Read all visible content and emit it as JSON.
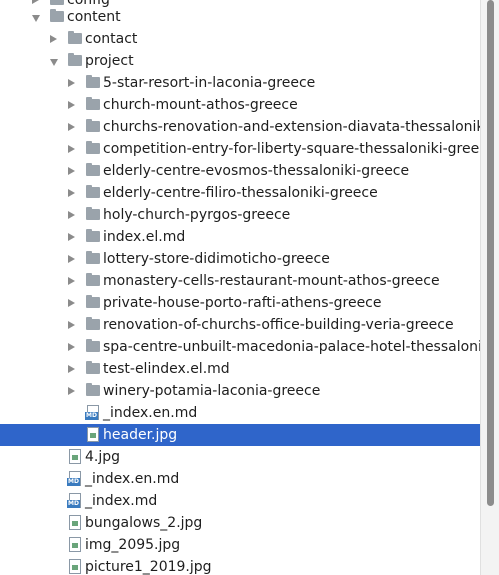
{
  "tree": {
    "partial_top": "config",
    "content": "content",
    "contact": "contact",
    "project": "project",
    "project_children": [
      "5-star-resort-in-laconia-greece",
      "church-mount-athos-greece",
      "churchs-renovation-and-extension-diavata-thessaloniki",
      "competition-entry-for-liberty-square-thessaloniki-greece",
      "elderly-centre-evosmos-thessaloniki-greece",
      "elderly-centre-filiro-thessaloniki-greece",
      "holy-church-pyrgos-greece",
      "index.el.md",
      "lottery-store-didimoticho-greece",
      "monastery-cells-restaurant-mount-athos-greece",
      "private-house-porto-rafti-athens-greece",
      "renovation-of-churchs-office-building-veria-greece",
      "spa-centre-unbuilt-macedonia-palace-hotel-thessaloniki",
      "test-elindex.el.md",
      "winery-potamia-laconia-greece"
    ],
    "project_files": [
      "_index.en.md",
      "header.jpg"
    ],
    "content_files": [
      "4.jpg",
      "_index.en.md",
      "_index.md",
      "bungalows_2.jpg",
      "img_2095.jpg",
      "picture1_2019.jpg"
    ],
    "md_badge": "MD"
  },
  "colors": {
    "selection": "#2f65ca",
    "folder": "#9aa3ab",
    "arrow": "#8b8b8b"
  }
}
